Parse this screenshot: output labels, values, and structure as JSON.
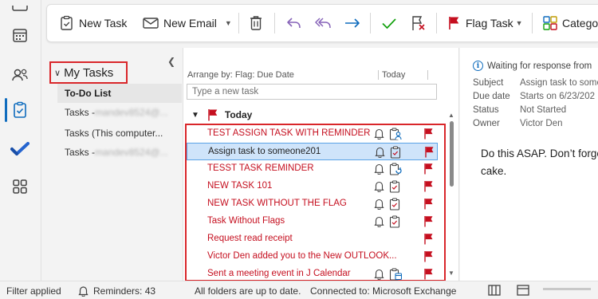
{
  "ribbon": {
    "new_task": "New Task",
    "new_email": "New Email",
    "flag_task": "Flag Task",
    "categorize": "Catego"
  },
  "folders": {
    "header": "My Tasks",
    "items": [
      {
        "label": "To-Do List",
        "selected": true
      },
      {
        "label": "Tasks - ",
        "blurred": "mandev8524@...",
        "selected": false
      },
      {
        "label": "Tasks (This computer...",
        "selected": false
      },
      {
        "label": "Tasks - ",
        "blurred": "mandev8524@...",
        "selected": false
      }
    ]
  },
  "list": {
    "arrange_by": "Arrange by: Flag: Due Date",
    "column": "Today",
    "new_task_placeholder": "Type a new task",
    "group": "Today",
    "tasks": [
      {
        "name": "TEST ASSIGN TASK WITH REMINDER",
        "bell": true,
        "task_icon": "assign",
        "selected": false
      },
      {
        "name": "Assign task to someone201",
        "bell": true,
        "task_icon": "task",
        "selected": true
      },
      {
        "name": "TESST TASK REMINDER",
        "bell": true,
        "task_icon": "recurring",
        "selected": false
      },
      {
        "name": "NEW TASK 101",
        "bell": true,
        "task_icon": "task",
        "selected": false
      },
      {
        "name": "NEW TASK WITHOUT THE FLAG",
        "bell": true,
        "task_icon": "task",
        "selected": false
      },
      {
        "name": "Task Without Flags",
        "bell": true,
        "task_icon": "task",
        "selected": false
      },
      {
        "name": "Request read receipt",
        "bell": false,
        "task_icon": "none",
        "selected": false
      },
      {
        "name": "Victor Den added you to the New OUTLOOK...",
        "bell": false,
        "task_icon": "none",
        "selected": false
      },
      {
        "name": "Sent a meeting event in J Calendar",
        "bell": true,
        "task_icon": "calendar",
        "selected": false
      }
    ]
  },
  "reading": {
    "info": "Waiting for response from",
    "subject_label": "Subject",
    "subject_value": "Assign task to some",
    "due_label": "Due date",
    "due_value": "Starts on 6/23/202",
    "status_label": "Status",
    "status_value": "Not Started",
    "owner_label": "Owner",
    "owner_value": "Victor Den",
    "body": "Do this ASAP. Don’t forget the cake."
  },
  "statusbar": {
    "filter": "Filter applied",
    "reminders": "Reminders: 43",
    "folders": "All folders are up to date.",
    "connected": "Connected to: Microsoft Exchange"
  },
  "colors": {
    "accent": "#0f6cbd",
    "flag_red": "#c50f1f",
    "highlight_box": "#d9262a",
    "selected_row": "#cfe4fa"
  }
}
